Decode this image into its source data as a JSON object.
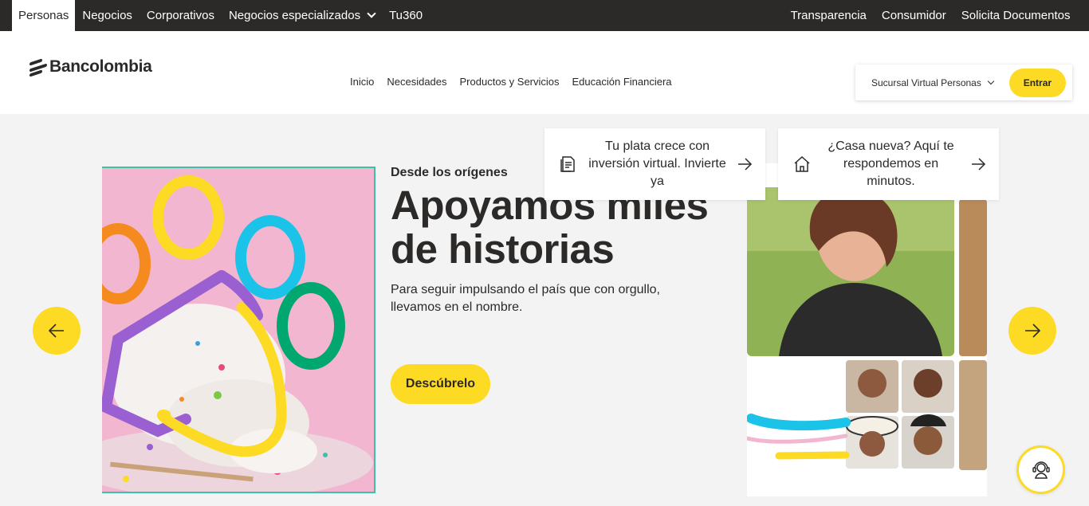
{
  "topbar": {
    "left_tabs": [
      {
        "label": "Personas",
        "active": true
      },
      {
        "label": "Negocios"
      },
      {
        "label": "Corporativos"
      },
      {
        "label": "Negocios especializados"
      },
      {
        "label": "Tu360"
      }
    ],
    "right_links": [
      "Transparencia",
      "Consumidor",
      "Solicita Documentos"
    ]
  },
  "header": {
    "logo_text": "Bancolombia",
    "nav": [
      "Inicio",
      "Necesidades",
      "Productos y Servicios",
      "Educación Financiera"
    ],
    "sucursal_label": "Sucursal Virtual Personas",
    "entrar_label": "Entrar"
  },
  "promo_cards": [
    {
      "text": "Tu plata crece con inversión virtual. Invierte ya",
      "icon": "document-icon"
    },
    {
      "text": "¿Casa nueva? Aquí te respondemos en minutos.",
      "icon": "house-icon"
    }
  ],
  "hero": {
    "kicker": "Desde los orígenes",
    "headline": "Apoyamos miles de historias",
    "subtext": "Para seguir impulsando el país que con orgullo, llevamos en el nombre.",
    "cta_label": "Descúbrelo"
  },
  "colors": {
    "brand_yellow": "#fdda24",
    "dark": "#2c2a29",
    "accent_teal": "#3ac2a7",
    "hero_pink": "#f2b6d0"
  }
}
